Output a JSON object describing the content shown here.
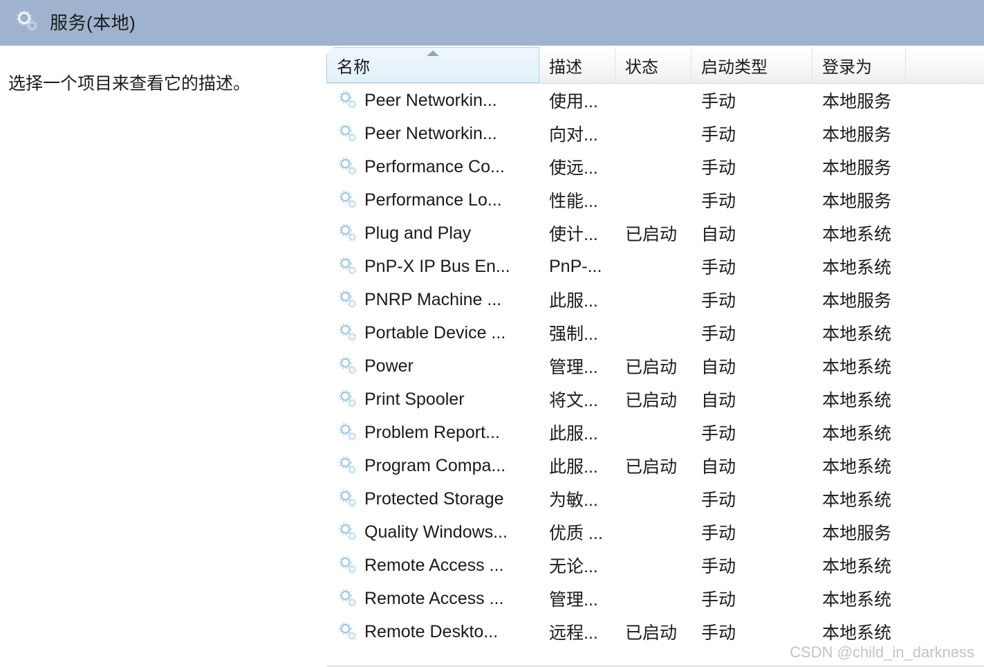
{
  "window": {
    "title": "服务(本地)",
    "title_icon": "services-gear-icon"
  },
  "description_pane": {
    "placeholder_text": "选择一个项目来查看它的描述。"
  },
  "list": {
    "sort_column": "名称",
    "sort_direction": "ascending",
    "columns": [
      {
        "label": "名称",
        "key": "name"
      },
      {
        "label": "描述",
        "key": "description"
      },
      {
        "label": "状态",
        "key": "status"
      },
      {
        "label": "启动类型",
        "key": "startup_type"
      },
      {
        "label": "登录为",
        "key": "log_on_as"
      }
    ],
    "row_icon": "service-gear-icon",
    "rows": [
      {
        "name": "Peer Networkin...",
        "description": "使用...",
        "status": "",
        "startup_type": "手动",
        "log_on_as": "本地服务"
      },
      {
        "name": "Peer Networkin...",
        "description": "向对...",
        "status": "",
        "startup_type": "手动",
        "log_on_as": "本地服务"
      },
      {
        "name": "Performance Co...",
        "description": "使远...",
        "status": "",
        "startup_type": "手动",
        "log_on_as": "本地服务"
      },
      {
        "name": "Performance Lo...",
        "description": "性能...",
        "status": "",
        "startup_type": "手动",
        "log_on_as": "本地服务"
      },
      {
        "name": "Plug and Play",
        "description": "使计...",
        "status": "已启动",
        "startup_type": "自动",
        "log_on_as": "本地系统"
      },
      {
        "name": "PnP-X IP Bus En...",
        "description": "PnP-...",
        "status": "",
        "startup_type": "手动",
        "log_on_as": "本地系统"
      },
      {
        "name": "PNRP Machine ...",
        "description": "此服...",
        "status": "",
        "startup_type": "手动",
        "log_on_as": "本地服务"
      },
      {
        "name": "Portable Device ...",
        "description": "强制...",
        "status": "",
        "startup_type": "手动",
        "log_on_as": "本地系统"
      },
      {
        "name": "Power",
        "description": "管理...",
        "status": "已启动",
        "startup_type": "自动",
        "log_on_as": "本地系统"
      },
      {
        "name": "Print Spooler",
        "description": "将文...",
        "status": "已启动",
        "startup_type": "自动",
        "log_on_as": "本地系统"
      },
      {
        "name": "Problem Report...",
        "description": "此服...",
        "status": "",
        "startup_type": "手动",
        "log_on_as": "本地系统"
      },
      {
        "name": "Program Compa...",
        "description": "此服...",
        "status": "已启动",
        "startup_type": "自动",
        "log_on_as": "本地系统"
      },
      {
        "name": "Protected Storage",
        "description": "为敏...",
        "status": "",
        "startup_type": "手动",
        "log_on_as": "本地系统"
      },
      {
        "name": "Quality Windows...",
        "description": "优质 ...",
        "status": "",
        "startup_type": "手动",
        "log_on_as": "本地服务"
      },
      {
        "name": "Remote Access ...",
        "description": "无论...",
        "status": "",
        "startup_type": "手动",
        "log_on_as": "本地系统"
      },
      {
        "name": "Remote Access ...",
        "description": "管理...",
        "status": "",
        "startup_type": "手动",
        "log_on_as": "本地系统"
      },
      {
        "name": "Remote Deskto...",
        "description": "远程...",
        "status": "已启动",
        "startup_type": "手动",
        "log_on_as": "本地系统"
      }
    ]
  },
  "watermark": {
    "text": "CSDN @child_in_darkness"
  },
  "colors": {
    "header_band": "#9fb3ce",
    "sorted_column": "#e2f1f9",
    "text": "#1a1a1a"
  }
}
